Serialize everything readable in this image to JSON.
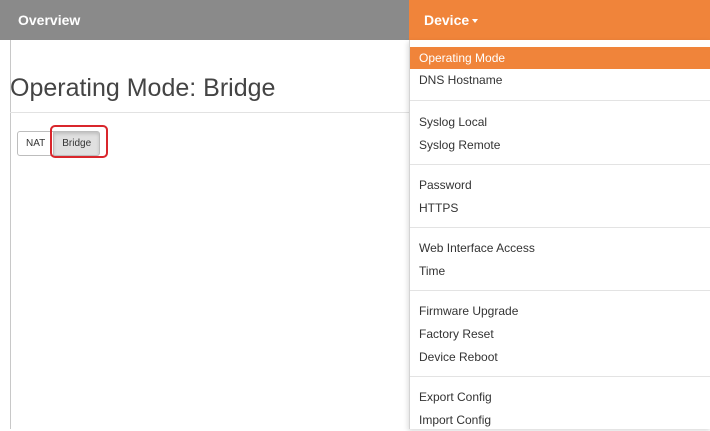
{
  "navbar": {
    "overview_label": "Overview",
    "device_label": "Device",
    "accent_color": "#f0843a",
    "bar_color": "#8a8a8a"
  },
  "page": {
    "title": "Operating Mode: Bridge"
  },
  "mode_toggle": {
    "options": [
      {
        "label": "NAT",
        "selected": false
      },
      {
        "label": "Bridge",
        "selected": true
      }
    ],
    "highlight_color": "#d9262c"
  },
  "device_menu": {
    "groups": [
      [
        {
          "label": "Operating Mode",
          "active": true
        },
        {
          "label": "DNS Hostname",
          "active": false
        }
      ],
      [
        {
          "label": "Syslog Local",
          "active": false
        },
        {
          "label": "Syslog Remote",
          "active": false
        }
      ],
      [
        {
          "label": "Password",
          "active": false
        },
        {
          "label": "HTTPS",
          "active": false
        }
      ],
      [
        {
          "label": "Web Interface Access",
          "active": false
        },
        {
          "label": "Time",
          "active": false
        }
      ],
      [
        {
          "label": "Firmware Upgrade",
          "active": false
        },
        {
          "label": "Factory Reset",
          "active": false
        },
        {
          "label": "Device Reboot",
          "active": false
        }
      ],
      [
        {
          "label": "Export Config",
          "active": false
        },
        {
          "label": "Import Config",
          "active": false
        }
      ]
    ]
  }
}
